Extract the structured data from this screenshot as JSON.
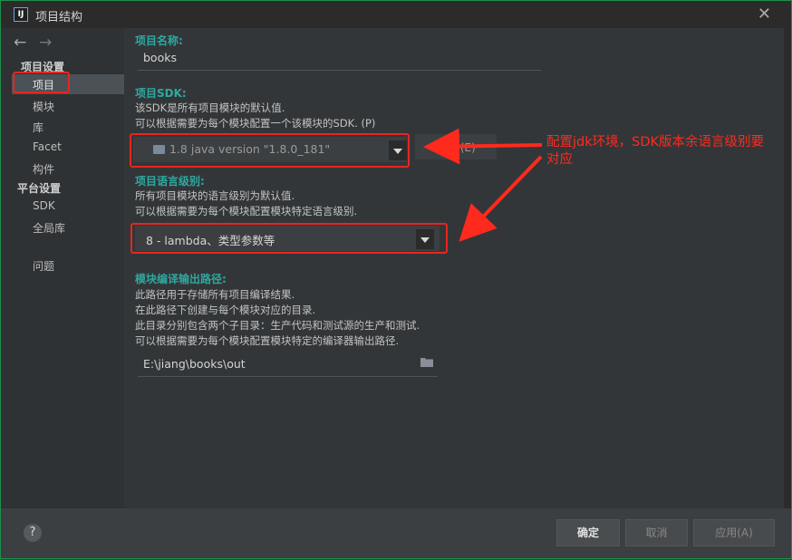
{
  "window": {
    "title": "项目结构",
    "close_icon": "close-icon",
    "app_icon_text": "IJ"
  },
  "nav": {
    "back": "←",
    "forward": "→"
  },
  "sidebar": {
    "section1": "项目设置",
    "items1": [
      "项目",
      "模块",
      "库",
      "Facet",
      "构件"
    ],
    "section2": "平台设置",
    "items2": [
      "SDK",
      "全局库"
    ],
    "problems": "问题"
  },
  "main": {
    "name_label": "项目名称:",
    "name_value": "books",
    "sdk_label": "项目SDK:",
    "sdk_desc1": "该SDK是所有项目模块的默认值.",
    "sdk_desc2": "可以根据需要为每个模块配置一个该模块的SDK. (P)",
    "sdk_value": "1.8 java version \"1.8.0_181\"",
    "new_button": "新建 (E)",
    "lang_label": "项目语言级别:",
    "lang_desc1": "所有项目模块的语言级别为默认值.",
    "lang_desc2": "可以根据需要为每个模块配置模块特定语言级别.",
    "lang_value": "8 - lambda、类型参数等",
    "out_label": "模块编译输出路径:",
    "out_desc1": "此路径用于存储所有项目编译结果.",
    "out_desc2": "在此路径下创建与每个模块对应的目录.",
    "out_desc3": "此目录分别包含两个子目录：生产代码和测试源的生产和测试.",
    "out_desc4": "可以根据需要为每个模块配置模块特定的编译器输出路径.",
    "out_value": "E:\\jiang\\books\\out"
  },
  "annotation": {
    "line1": "配置jdk环境，SDK版本余语言级别要",
    "line2": "对应",
    "color": "#ff2a1e"
  },
  "footer": {
    "help": "?",
    "ok": "确定",
    "cancel": "取消",
    "apply": "应用(A)"
  }
}
